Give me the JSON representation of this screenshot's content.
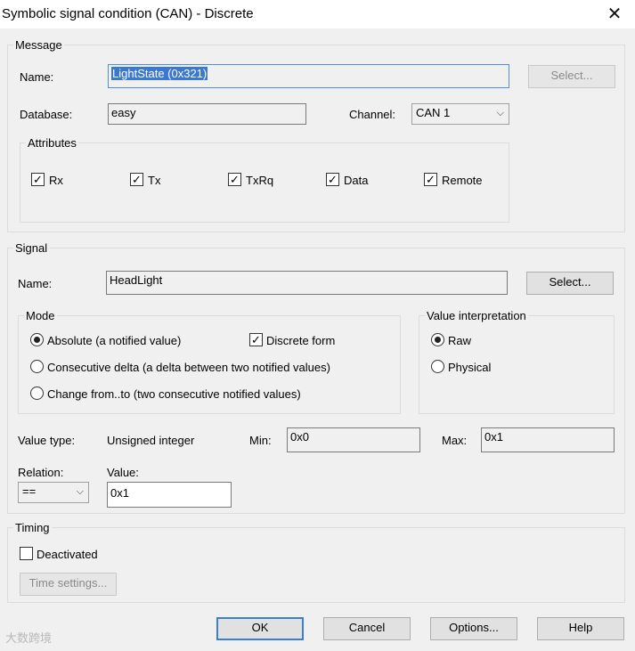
{
  "window": {
    "title": "Symbolic signal condition (CAN) - Discrete",
    "close_glyph": "✕"
  },
  "message": {
    "group_label": "Message",
    "name_label": "Name:",
    "name_value": "LightState (0x321)",
    "select_label": "Select...",
    "database_label": "Database:",
    "database_value": "easy",
    "channel_label": "Channel:",
    "channel_value": "CAN 1",
    "attributes_label": "Attributes",
    "attributes": [
      {
        "label": "Rx",
        "checked": true
      },
      {
        "label": "Tx",
        "checked": true
      },
      {
        "label": "TxRq",
        "checked": true
      },
      {
        "label": "Data",
        "checked": true
      },
      {
        "label": "Remote",
        "checked": true
      }
    ]
  },
  "signal": {
    "group_label": "Signal",
    "name_label": "Name:",
    "name_value": "HeadLight",
    "select_label": "Select...",
    "mode_label": "Mode",
    "modes": [
      {
        "label": "Absolute (a notified value)",
        "selected": true
      },
      {
        "label": "Consecutive delta (a delta between two notified values)",
        "selected": false
      },
      {
        "label": "Change from..to (two consecutive notified values)",
        "selected": false
      }
    ],
    "discrete_form_label": "Discrete form",
    "discrete_form_checked": true,
    "value_interp_label": "Value interpretation",
    "interp_options": [
      {
        "label": "Raw",
        "selected": true
      },
      {
        "label": "Physical",
        "selected": false
      }
    ],
    "value_type_label": "Value type:",
    "value_type_value": "Unsigned integer",
    "min_label": "Min:",
    "min_value": "0x0",
    "max_label": "Max:",
    "max_value": "0x1",
    "relation_label": "Relation:",
    "relation_value": "==",
    "value_label": "Value:",
    "value_value": "0x1"
  },
  "timing": {
    "group_label": "Timing",
    "deactivated_label": "Deactivated",
    "deactivated_checked": false,
    "time_settings_label": "Time settings..."
  },
  "buttons": {
    "ok": "OK",
    "cancel": "Cancel",
    "options": "Options...",
    "help": "Help"
  },
  "watermark": "大数跨境",
  "icons": {
    "check": "✓",
    "dropdown": "⌵"
  }
}
